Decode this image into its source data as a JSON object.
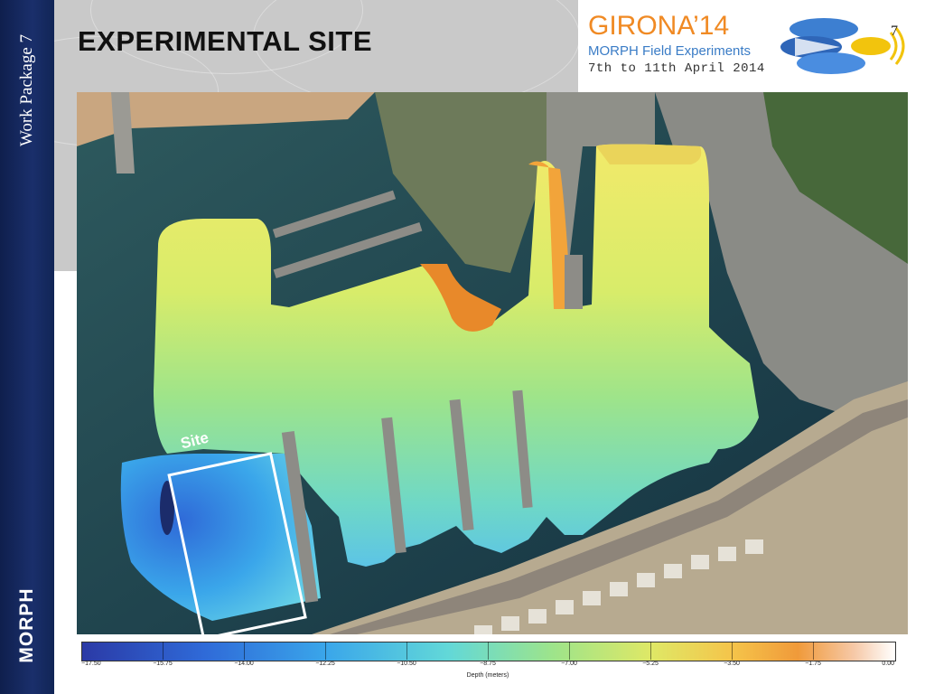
{
  "slide": {
    "title": "EXPERIMENTAL SITE",
    "page_number": "7",
    "vertical_label": "Work Package 7",
    "brand": "MORPH"
  },
  "conference": {
    "name": "GIRONA’14",
    "subtitle": "MORPH Field Experiments",
    "dates": "7th to 11th April 2014"
  },
  "map": {
    "site_label": "Site"
  },
  "colorbar": {
    "label": "Depth (meters)",
    "ticks": [
      "−17.50",
      "−15.75",
      "−14.00",
      "−12.25",
      "−10.50",
      "−8.75",
      "−7.00",
      "−5.25",
      "−3.50",
      "−1.75",
      "0.00"
    ]
  },
  "colors": {
    "sidebar": "#112556",
    "conference_name": "#f08a24",
    "conference_subtitle": "#3a7cc6"
  }
}
